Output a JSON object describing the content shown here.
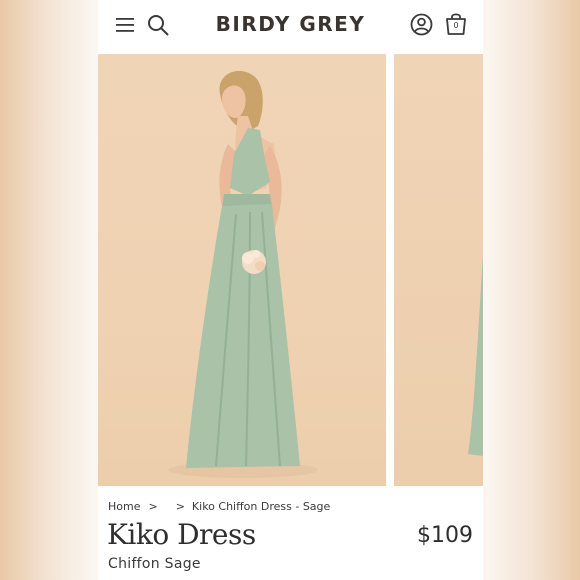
{
  "brand": {
    "logo_text": "BIRDY GREY"
  },
  "header": {
    "menu_icon": "hamburger-menu-icon",
    "search_icon": "search-icon",
    "account_icon": "account-icon",
    "bag_icon": "shopping-bag-icon",
    "bag_count": "0"
  },
  "gallery": {
    "images": [
      {
        "subject": "model in sage chiffon gown holding flowers"
      },
      {
        "subject": "partial view of next product photo"
      }
    ]
  },
  "breadcrumb": {
    "home": "Home",
    "separator": ">",
    "current": "Kiko Chiffon Dress - Sage"
  },
  "product": {
    "name": "Kiko Dress",
    "price": "$109",
    "variant": "Chiffon Sage"
  },
  "colors": {
    "dress": "#a9c2a8",
    "backdrop": "#efd2b2",
    "text": "#2e2e2e"
  }
}
